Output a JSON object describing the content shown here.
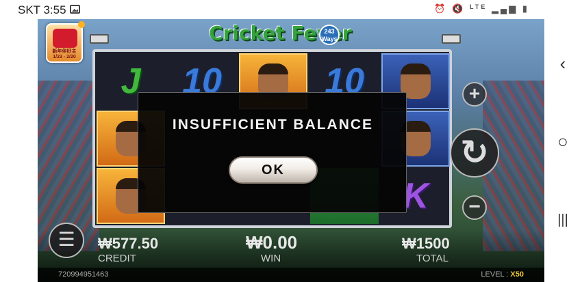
{
  "status_bar": {
    "carrier_time": "SKT 3:55",
    "network": "LTE"
  },
  "nav_bar": {
    "back": "‹",
    "home": "○",
    "recents": "|||"
  },
  "game": {
    "title": "Cricket Fever",
    "ways": "243",
    "ways_label": "Ways",
    "promo_text": "新年伴好主 1/23 - 2/20",
    "reels": [
      [
        "J",
        "player",
        "player"
      ],
      [
        "10",
        "",
        ""
      ],
      [
        "player",
        "",
        ""
      ],
      [
        "10",
        "",
        "green"
      ],
      [
        "player2",
        "player2",
        "K"
      ]
    ]
  },
  "stats": {
    "credit_value": "₩577.50",
    "credit_label": "CREDIT",
    "win_value": "₩0.00",
    "win_label": "WIN",
    "total_value": "₩1500",
    "total_label": "TOTAL"
  },
  "footer": {
    "id": "720994951463",
    "level_label": "LEVEL :",
    "level_value": "X50"
  },
  "modal": {
    "message": "INSUFFICIENT BALANCE",
    "ok_label": "OK"
  },
  "controls": {
    "plus": "+",
    "minus": "−",
    "spin": "↻",
    "menu": "☰"
  }
}
